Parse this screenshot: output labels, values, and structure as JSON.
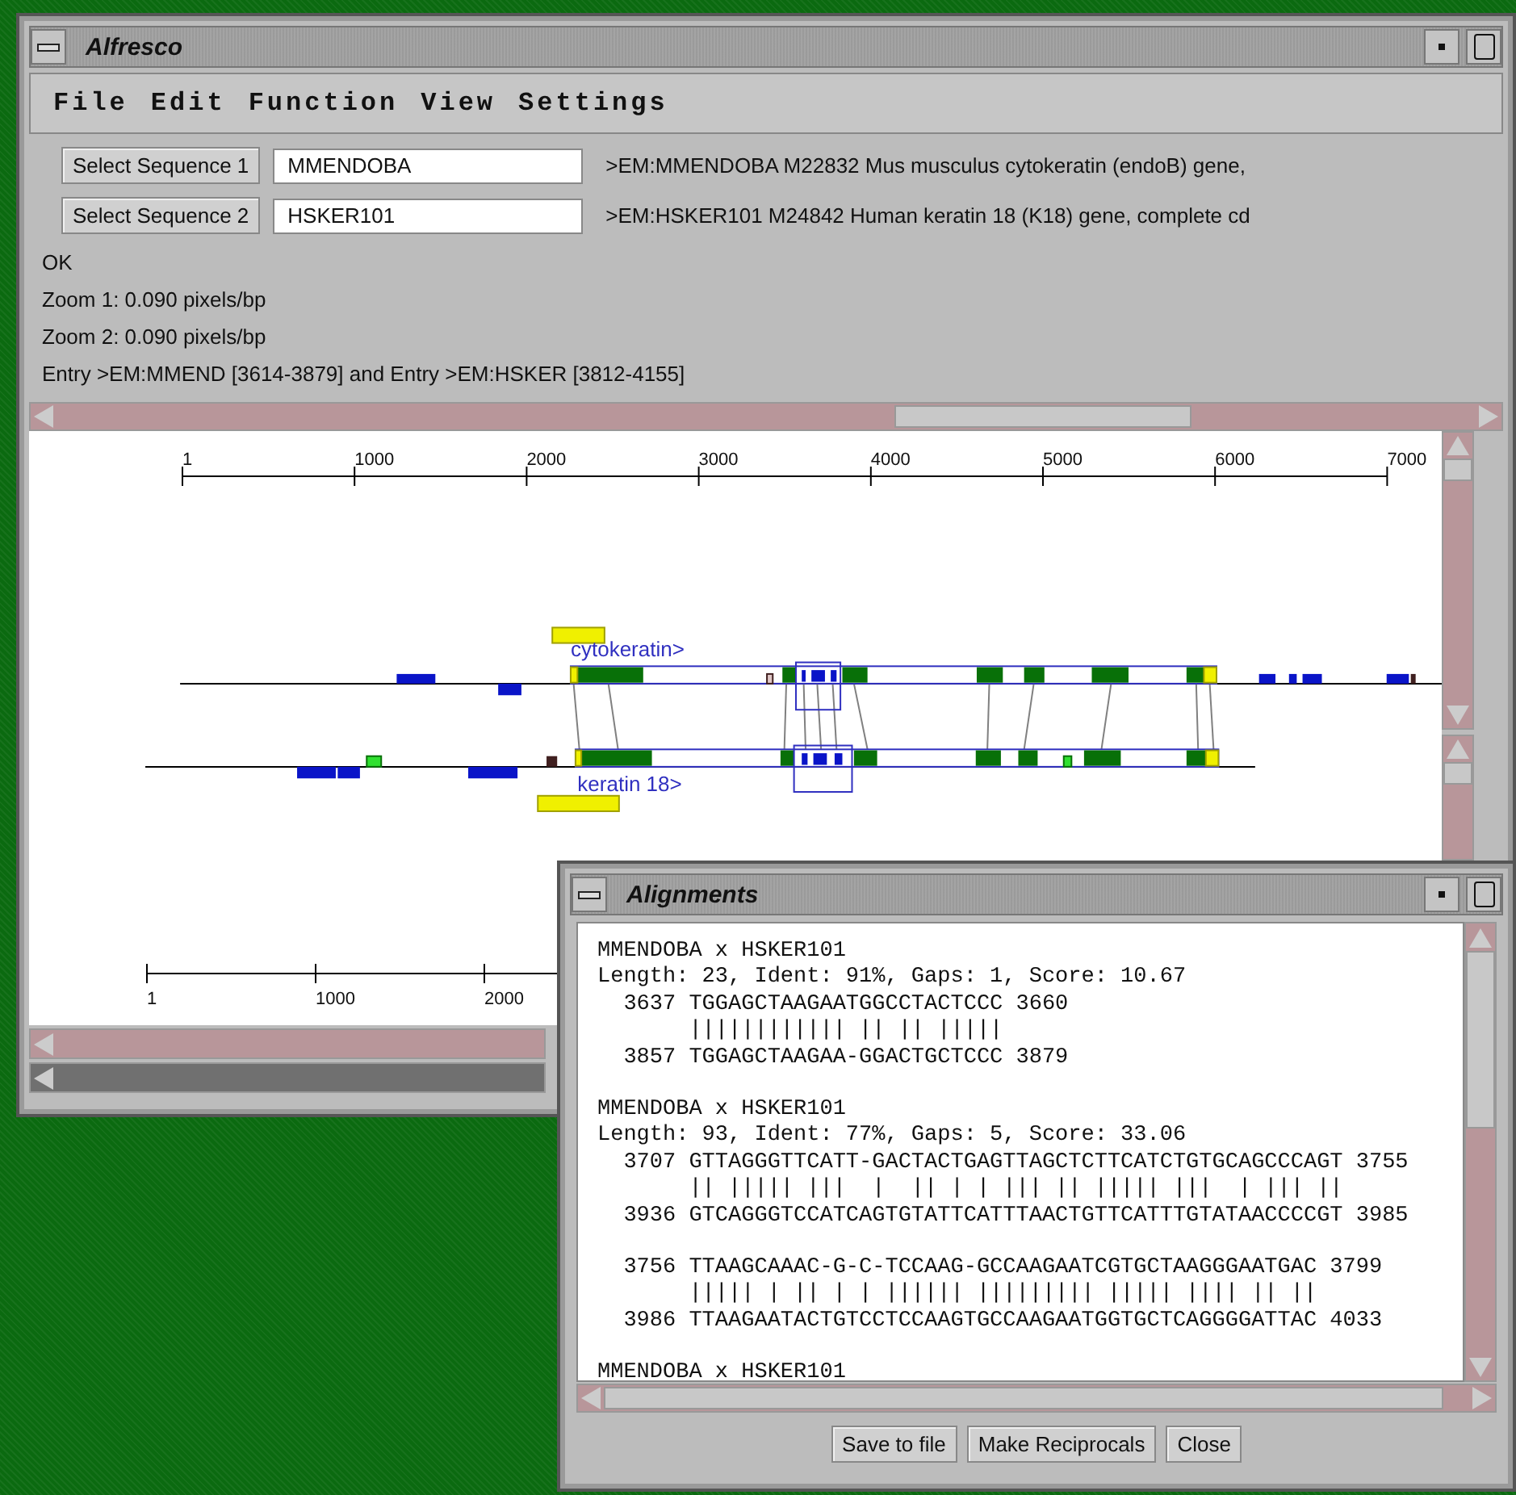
{
  "window": {
    "title": "Alfresco"
  },
  "menu": [
    "File",
    "Edit",
    "Function",
    "View",
    "Settings"
  ],
  "sequences": [
    {
      "button": "Select Sequence 1",
      "value": "MMENDOBA",
      "description": ">EM:MMENDOBA M22832 Mus musculus cytokeratin (endoB) gene,"
    },
    {
      "button": "Select Sequence 2",
      "value": "HSKER101",
      "description": ">EM:HSKER101 M24842 Human keratin 18 (K18) gene, complete cd"
    }
  ],
  "status_lines": [
    "OK",
    "Zoom 1: 0.090 pixels/bp",
    "Zoom 2: 0.090 pixels/bp",
    "Entry >EM:MMEND [3614-3879] and Entry >EM:HSKER [3812-4155]"
  ],
  "map": {
    "top_ruler": [
      "1",
      "1000",
      "2000",
      "3000",
      "4000",
      "5000",
      "6000",
      "7000"
    ],
    "feature_labels": [
      "cytokeratin>",
      "keratin 18>"
    ],
    "bottom_ruler": [
      "1",
      "1000",
      "2000"
    ]
  },
  "alignments_window": {
    "title": "Alignments",
    "blocks": [
      {
        "header": "MMENDOBA x HSKER101",
        "stats": "Length: 23, Ident: 91%, Gaps: 1, Score: 10.67",
        "segments": [
          [
            "  3637 TGGAGCTAAGAATGGCCTACTCCC 3660",
            "       |||||||||||| || || |||||",
            "  3857 TGGAGCTAAGAA-GGACTGCTCCC 3879"
          ]
        ]
      },
      {
        "header": "MMENDOBA x HSKER101",
        "stats": "Length: 93, Ident: 77%, Gaps: 5, Score: 33.06",
        "segments": [
          [
            "  3707 GTTAGGGTTCATT-GACTACTGAGTTAGCTCTTCATCTGTGCAGCCCAGT 3755",
            "       || ||||| |||  |  || | | ||| || ||||| |||  | ||| ||",
            "  3936 GTCAGGGTCCATCAGTGTATTCATTTAACTGTTCATTTGTATAACCCCGT 3985"
          ],
          [
            "  3756 TTAAGCAAAC-G-C-TCCAAG-GCCAAGAATCGTGCTAAGGGAATGAC 3799",
            "       ||||| | || | | |||||| ||||||||| ||||| |||| || ||",
            "  3986 TTAAGAATACTGTCCTCCAAGTGCCAAGAATGGTGCTCAGGGGATTAC 4033"
          ]
        ]
      },
      {
        "header": "MMENDOBA x HSKER101"
      }
    ],
    "buttons": [
      "Save to file",
      "Make Reciprocals",
      "Close"
    ]
  }
}
